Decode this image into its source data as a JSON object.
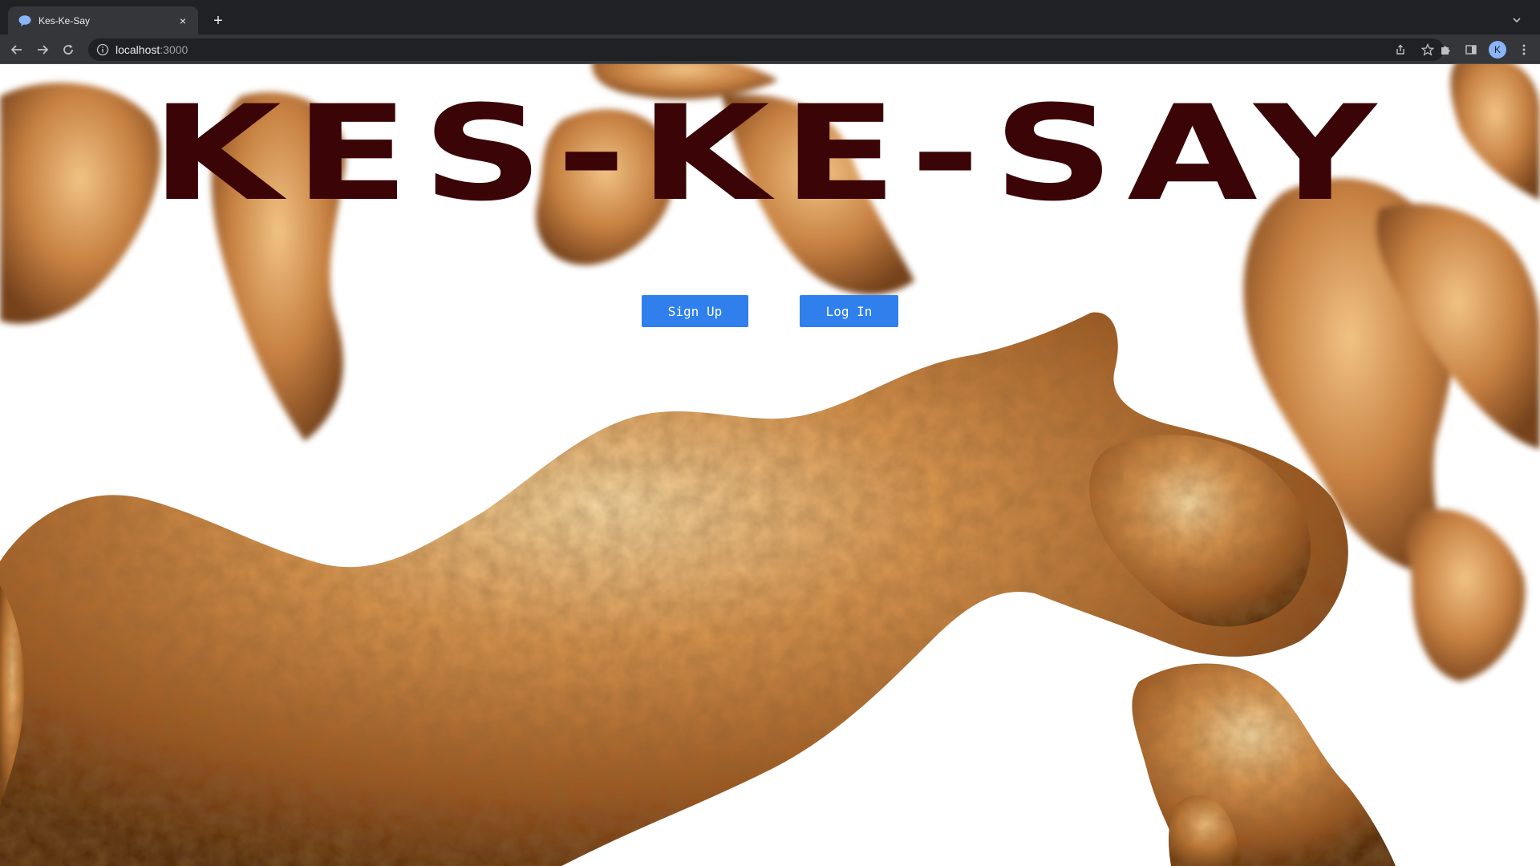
{
  "browser": {
    "tab_title": "Kes-Ke-Say",
    "new_tab_symbol": "+",
    "close_symbol": "×",
    "url_host": "localhost",
    "url_port": ":3000",
    "profile_initial": "K"
  },
  "page": {
    "title": "KES-KE-SAY",
    "buttons": {
      "signup": "Sign Up",
      "login": "Log In"
    }
  },
  "colors": {
    "title": "#3b0508",
    "button": "#2f80ed",
    "blob_light": "#f2c98a",
    "blob_mid": "#c57a3b",
    "blob_dark": "#6b3410"
  }
}
